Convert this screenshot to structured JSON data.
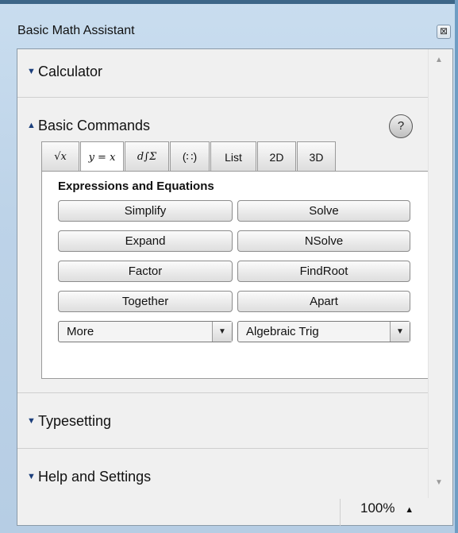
{
  "window": {
    "title": "Basic Math Assistant",
    "close_label": "⊠"
  },
  "sections": {
    "calculator": {
      "label": "Calculator"
    },
    "basic_commands": {
      "label": "Basic Commands",
      "help_label": "?"
    },
    "typesetting": {
      "label": "Typesetting"
    },
    "help_settings": {
      "label": "Help and Settings"
    }
  },
  "tabs": [
    {
      "label": "√x",
      "active": false
    },
    {
      "label": "y = x",
      "active": true
    },
    {
      "label": "d∫Σ",
      "active": false
    },
    {
      "label": "(∷)",
      "active": false
    },
    {
      "label": "List",
      "active": false
    },
    {
      "label": "2D",
      "active": false
    },
    {
      "label": "3D",
      "active": false
    }
  ],
  "panel": {
    "group_label": "Expressions and Equations",
    "buttons": [
      "Simplify",
      "Solve",
      "Expand",
      "NSolve",
      "Factor",
      "FindRoot",
      "Together",
      "Apart"
    ],
    "dropdowns": [
      {
        "value": "More"
      },
      {
        "value": "Algebraic Trig"
      }
    ]
  },
  "zoom": {
    "value": "100%",
    "arrow": "▲"
  }
}
